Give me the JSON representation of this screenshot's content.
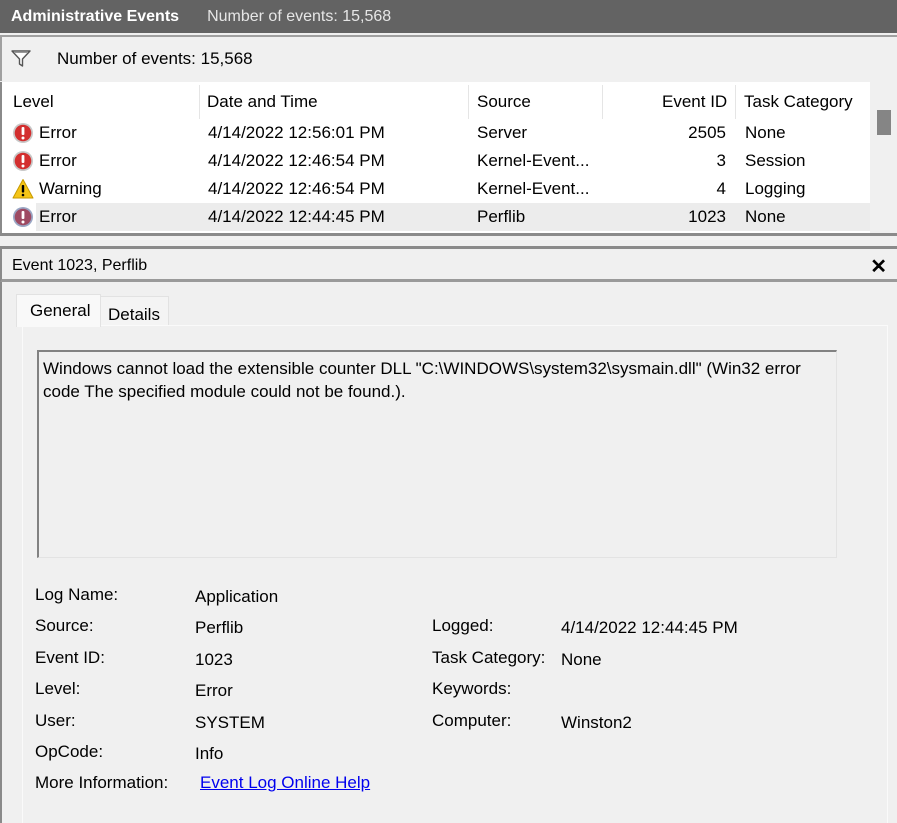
{
  "titlebar": {
    "title": "Administrative Events",
    "count": "Number of events: 15,568"
  },
  "filterbar": {
    "icon": "filter-funnel-icon",
    "count": "Number of events: 15,568"
  },
  "event_list": {
    "columns": [
      "Level",
      "Date and Time",
      "Source",
      "Event ID",
      "Task Category"
    ],
    "rows": [
      {
        "level": "Error",
        "icon": "error-icon",
        "datetime": "4/14/2022 12:56:01 PM",
        "source": "Server",
        "event_id": "2505",
        "task_category": "None",
        "selected": false
      },
      {
        "level": "Error",
        "icon": "error-icon",
        "datetime": "4/14/2022 12:46:54 PM",
        "source": "Kernel-Event...",
        "event_id": "3",
        "task_category": "Session",
        "selected": false
      },
      {
        "level": "Warning",
        "icon": "warning-icon",
        "datetime": "4/14/2022 12:46:54 PM",
        "source": "Kernel-Event...",
        "event_id": "4",
        "task_category": "Logging",
        "selected": false
      },
      {
        "level": "Error",
        "icon": "error-icon",
        "datetime": "4/14/2022 12:44:45 PM",
        "source": "Perflib",
        "event_id": "1023",
        "task_category": "None",
        "selected": true
      }
    ]
  },
  "detail": {
    "title": "Event 1023, Perflib",
    "close_icon": "close-icon",
    "tabs": [
      {
        "label": "General",
        "active": true
      },
      {
        "label": "Details",
        "active": false
      }
    ],
    "description": "Windows cannot load the extensible counter DLL \"C:\\WINDOWS\\system32\\sysmain.dll\" (Win32 error code The specified module could not be found.).",
    "properties_left": [
      {
        "label": "Log Name:",
        "value": "Application"
      },
      {
        "label": "Source:",
        "value": "Perflib"
      },
      {
        "label": "Event ID:",
        "value": "1023"
      },
      {
        "label": "Level:",
        "value": "Error"
      },
      {
        "label": "User:",
        "value": "SYSTEM"
      },
      {
        "label": "OpCode:",
        "value": "Info"
      },
      {
        "label": "More Information:",
        "value": "Event Log Online Help"
      }
    ],
    "properties_right": [
      {
        "label": "Logged:",
        "value": "4/14/2022 12:44:45 PM"
      },
      {
        "label": "Task Category:",
        "value": "None"
      },
      {
        "label": "Keywords:",
        "value": ""
      },
      {
        "label": "Computer:",
        "value": "Winston2"
      }
    ]
  }
}
